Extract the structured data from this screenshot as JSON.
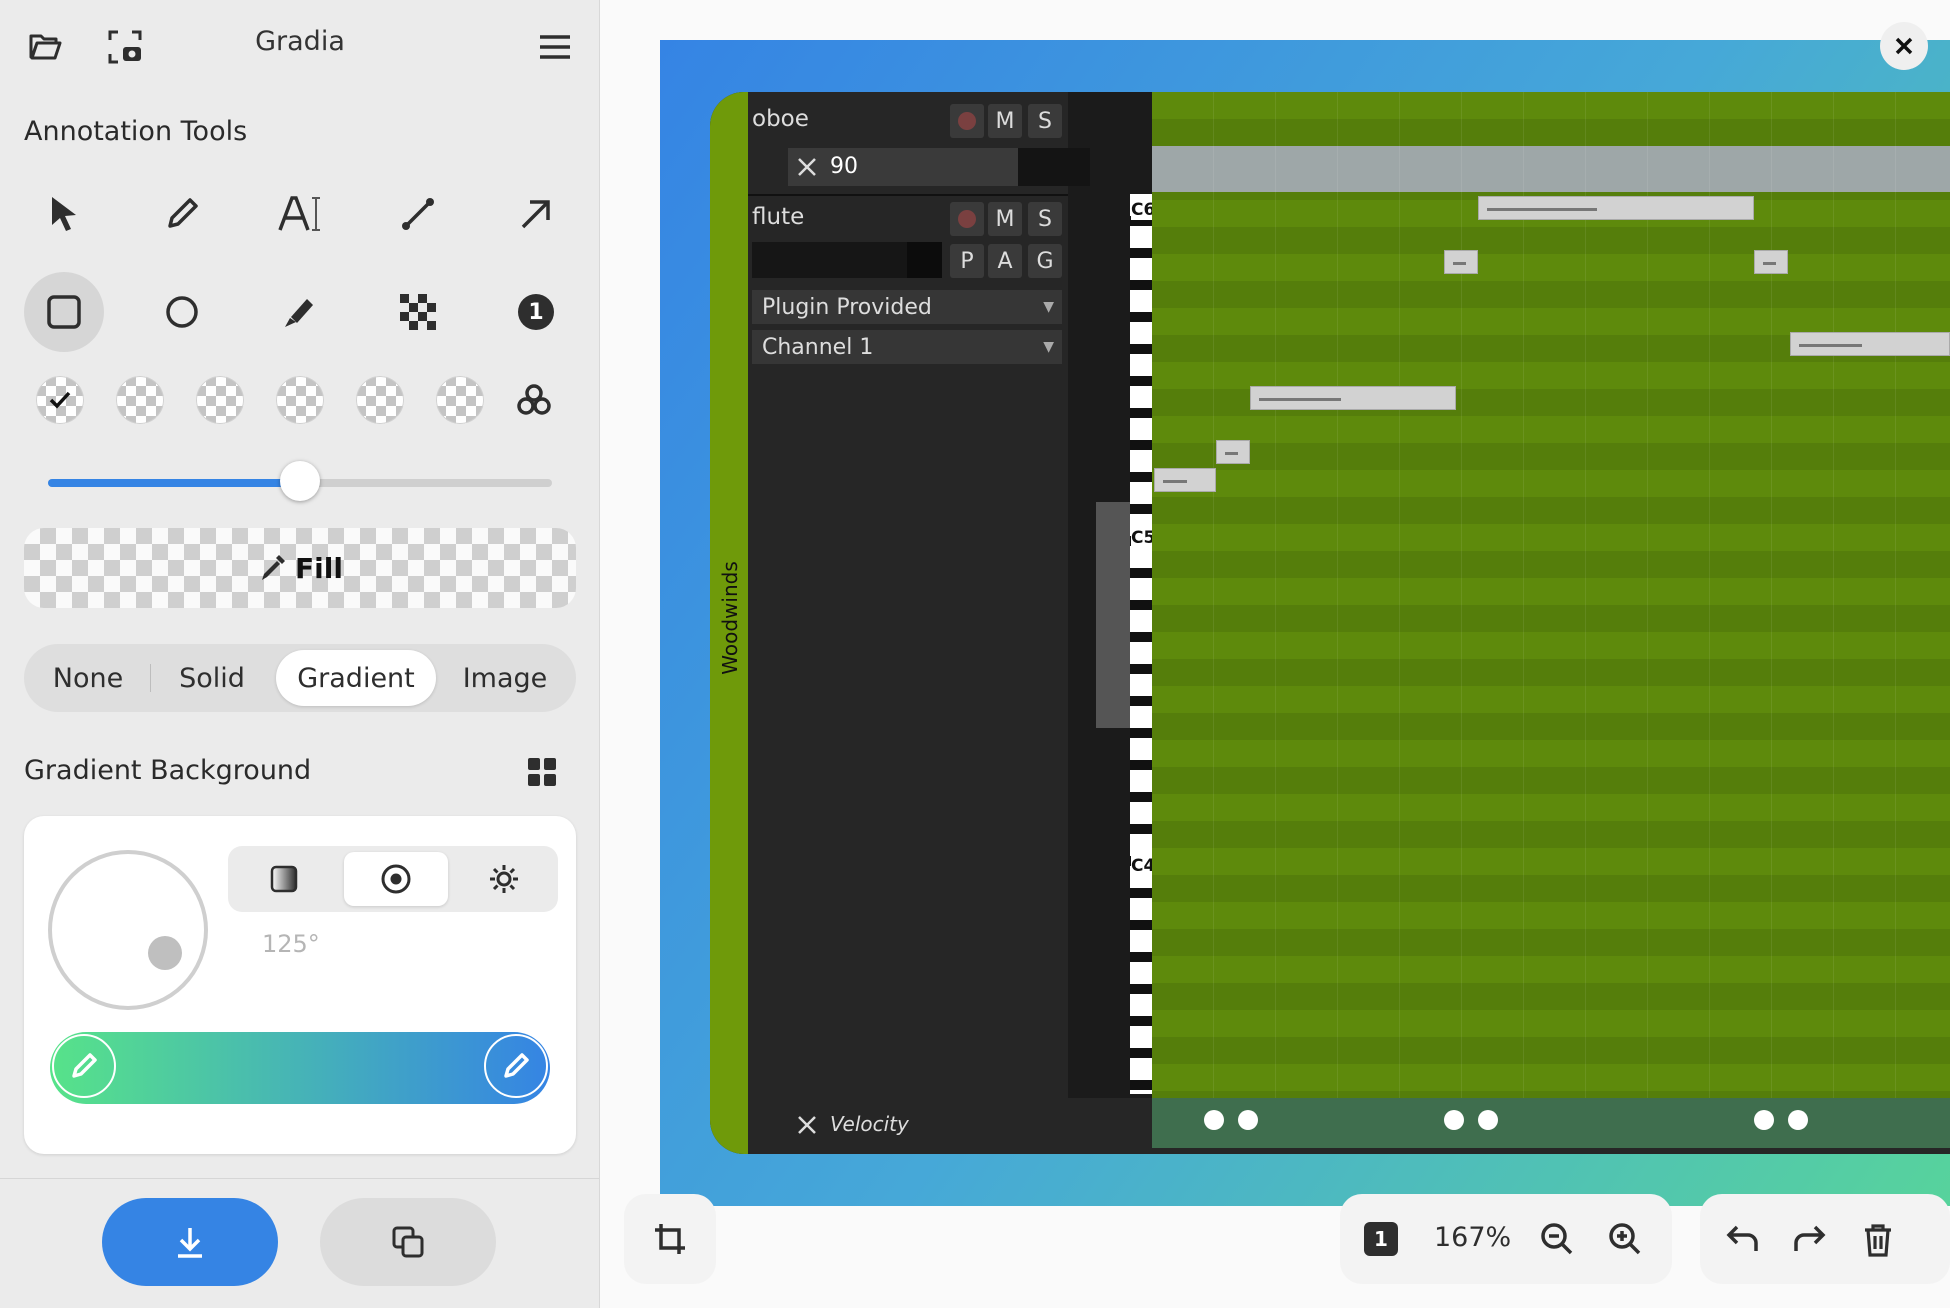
{
  "header": {
    "title": "Gradia"
  },
  "annotation": {
    "heading": "Annotation Tools",
    "tools_row1": [
      "select-tool",
      "pen-tool",
      "text-tool",
      "line-tool",
      "arrow-tool"
    ],
    "tools_row2": [
      "rectangle-tool",
      "circle-tool",
      "highlighter-tool",
      "pixelate-tool",
      "number-tool"
    ],
    "number_tool_label": "1",
    "slider_value_fraction": 0.5
  },
  "fill": {
    "label": "Fill"
  },
  "background_modes": {
    "options": [
      "None",
      "Solid",
      "Gradient",
      "Image"
    ],
    "selected": "Gradient"
  },
  "gradient": {
    "heading": "Gradient Background",
    "types": [
      "linear",
      "radial",
      "conic"
    ],
    "selected_type": "radial",
    "angle": "125°",
    "start_color": "#57e389",
    "end_color": "#3584e4"
  },
  "canvas": {
    "zoom_badge": "1",
    "zoom_level": "167%",
    "daw": {
      "group_label": "Woodwinds",
      "tracks": [
        {
          "name": "oboe",
          "buttons": [
            "M",
            "S"
          ],
          "value": "90"
        },
        {
          "name": "flute",
          "buttons": [
            "M",
            "S"
          ],
          "buttons2": [
            "P",
            "A",
            "G"
          ],
          "plugin": "Plugin Provided",
          "channel": "Channel 1"
        }
      ],
      "octave_labels": [
        "C6",
        "C5",
        "C4"
      ],
      "velocity_label": "Velocity"
    }
  }
}
